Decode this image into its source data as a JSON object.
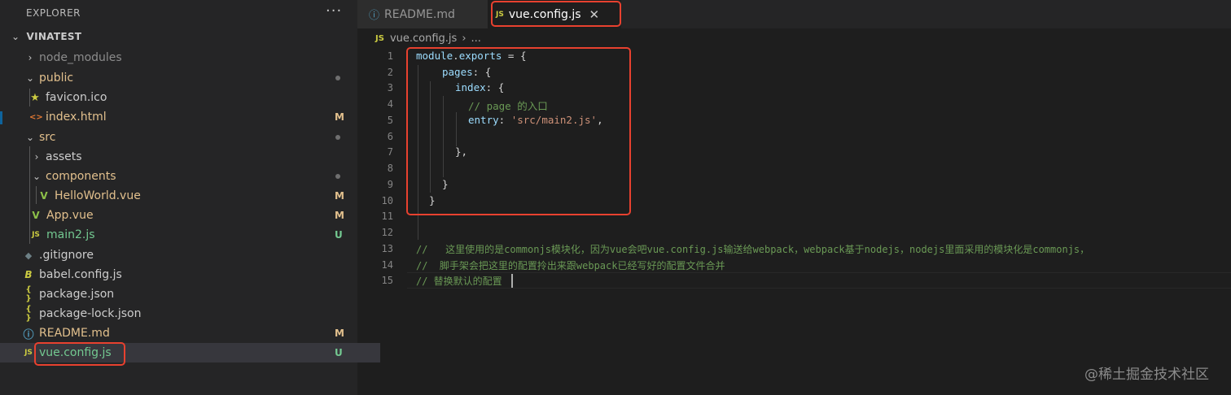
{
  "sidebar": {
    "header": "EXPLORER",
    "more": "···",
    "root": "VINATEST",
    "items": [
      {
        "label": "node_modules",
        "chev": "›",
        "icon": "",
        "status": ""
      },
      {
        "label": "public",
        "chev": "⌄",
        "icon": "",
        "status": ""
      },
      {
        "label": "favicon.ico",
        "chev": "",
        "icon": "★",
        "status": ""
      },
      {
        "label": "index.html",
        "chev": "",
        "icon": "<>",
        "status": "M"
      },
      {
        "label": "src",
        "chev": "⌄",
        "icon": "",
        "status": ""
      },
      {
        "label": "assets",
        "chev": "›",
        "icon": "",
        "status": ""
      },
      {
        "label": "components",
        "chev": "⌄",
        "icon": "",
        "status": ""
      },
      {
        "label": "HelloWorld.vue",
        "chev": "",
        "icon": "V",
        "status": "M"
      },
      {
        "label": "App.vue",
        "chev": "",
        "icon": "V",
        "status": "M"
      },
      {
        "label": "main2.js",
        "chev": "",
        "icon": "JS",
        "status": "U"
      },
      {
        "label": ".gitignore",
        "chev": "",
        "icon": "◆",
        "status": ""
      },
      {
        "label": "babel.config.js",
        "chev": "",
        "icon": "B",
        "status": ""
      },
      {
        "label": "package.json",
        "chev": "",
        "icon": "{ }",
        "status": ""
      },
      {
        "label": "package-lock.json",
        "chev": "",
        "icon": "{ }",
        "status": ""
      },
      {
        "label": "README.md",
        "chev": "",
        "icon": "ⓘ",
        "status": "M"
      },
      {
        "label": "vue.config.js",
        "chev": "",
        "icon": "JS",
        "status": "U"
      }
    ]
  },
  "tabs": [
    {
      "icon": "ⓘ",
      "label": "README.md"
    },
    {
      "icon": "JS",
      "label": "vue.config.js",
      "close": "✕"
    }
  ],
  "breadcrumb": {
    "icon": "JS",
    "file": "vue.config.js",
    "sep": "›",
    "rest": "..."
  },
  "editor": {
    "line_numbers": [
      "1",
      "2",
      "3",
      "4",
      "5",
      "6",
      "7",
      "8",
      "9",
      "10",
      "11",
      "12",
      "13",
      "14",
      "15"
    ],
    "lines": [
      {
        "a": "module",
        "b": ".",
        "c": "exports",
        "d": " = {"
      },
      {
        "a": "pages",
        "b": ": {"
      },
      {
        "a": "index",
        "b": ": {"
      },
      {
        "a": "// page 的入口"
      },
      {
        "a": "entry",
        "b": ": ",
        "c": "'src/main2.js'",
        "d": ","
      },
      {
        "a": ""
      },
      {
        "a": "},"
      },
      {
        "a": ""
      },
      {
        "a": "}"
      },
      {
        "a": "}"
      },
      {
        "a": ""
      },
      {
        "a": ""
      },
      {
        "a": "//   这里使用的是commonjs模块化，因为vue会吧vue.config.js输送给webpack，webpack基于nodejs，nodejs里面采用的模块化是commonjs，"
      },
      {
        "a": "//  脚手架会把这里的配置拎出来跟webpack已经写好的配置文件合并"
      },
      {
        "a": "// 替换默认的配置"
      }
    ]
  },
  "watermark": "@稀土掘金技术社区",
  "colors": {
    "highlight": "#e8412f",
    "modified": "#e2c08d",
    "untracked": "#73c991",
    "comment": "#6a9955",
    "string": "#ce9178",
    "property": "#9cdcfe"
  }
}
